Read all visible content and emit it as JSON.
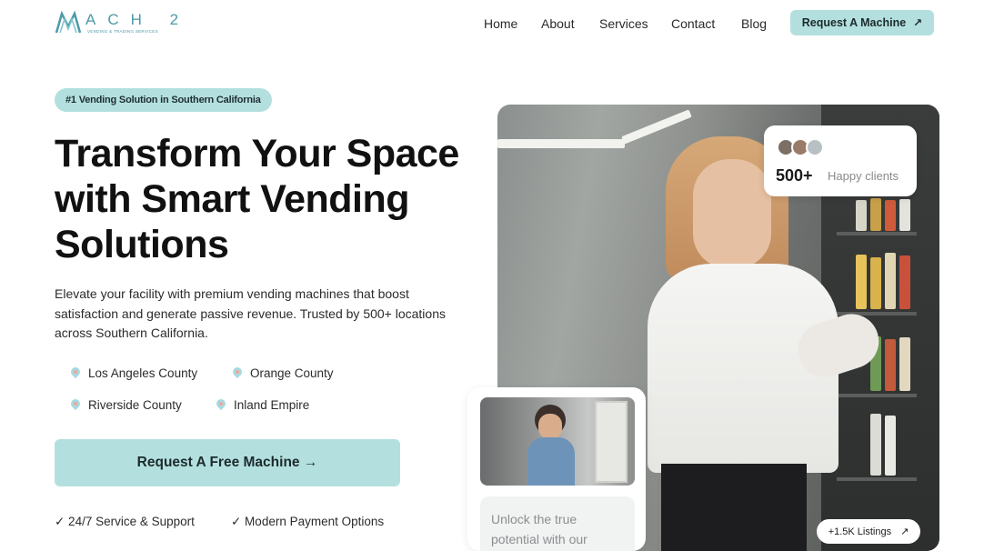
{
  "brand": {
    "logo_word": "ACH 2",
    "logo_sub": "VENDING & TRADING SERVICES"
  },
  "nav": {
    "items": [
      "Home",
      "About",
      "Services",
      "Contact",
      "Blog"
    ]
  },
  "header_button": {
    "label": "Request A Machine",
    "icon": "arrow-up-right-icon"
  },
  "hero": {
    "badge": "#1 Vending Solution in Southern California",
    "title": "Transform Your Space with Smart Vending Solutions",
    "description": "Elevate your facility with premium vending machines that boost satisfaction and generate passive revenue. Trusted by 500+ locations across Southern California.",
    "locations": [
      "Los Angeles County",
      "Orange County",
      "Riverside County",
      "Inland Empire"
    ],
    "cta_label": "Request A Free Machine →",
    "features": [
      "✓ 24/7 Service & Support",
      "✓ Modern Payment Options"
    ]
  },
  "clients_card": {
    "count": "500+",
    "label": "Happy clients"
  },
  "thumb_card": {
    "note": "Unlock the true potential with our"
  },
  "listings_badge": {
    "label": "+1.5K Listings",
    "icon": "arrow-up-right-icon"
  },
  "colors": {
    "accent": "#b3e0df",
    "brand": "#4d9aa8",
    "text": "#111111"
  }
}
